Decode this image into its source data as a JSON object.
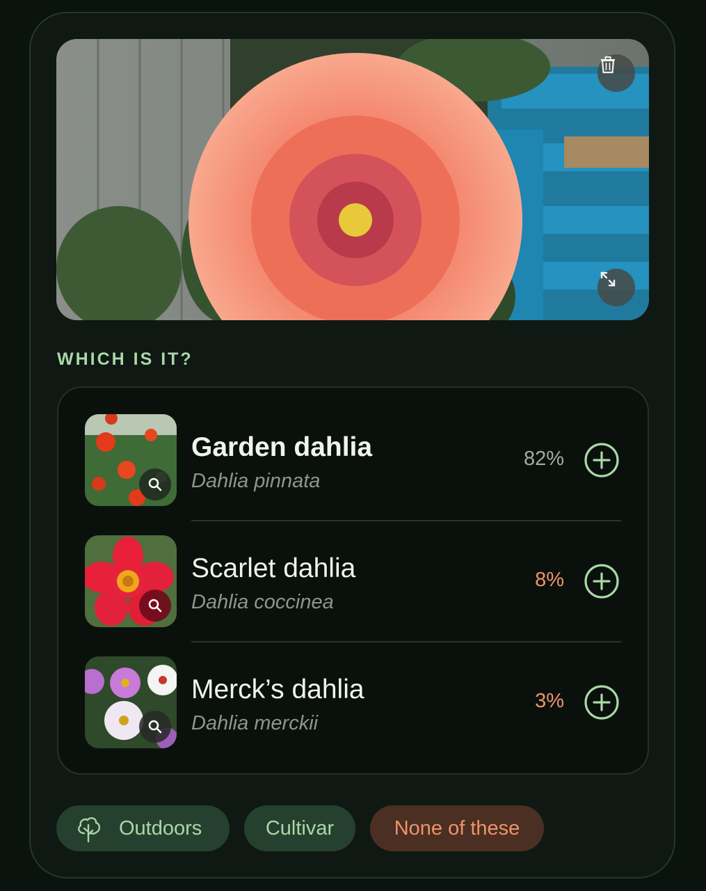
{
  "photo": {
    "subject": "dahlia-flower-photo",
    "delete_icon": "trash-icon",
    "expand_icon": "expand-icon"
  },
  "section_title": "WHICH IS IT?",
  "candidates": [
    {
      "name": "Garden dahlia",
      "scientific": "Dahlia pinnata",
      "confidence": "82%",
      "confidence_color": "#a4aba6",
      "icon": "plus-circle-icon"
    },
    {
      "name": "Scarlet dahlia",
      "scientific": "Dahlia coccinea",
      "confidence": "8%",
      "confidence_color": "#f0936b",
      "icon": "plus-circle-icon"
    },
    {
      "name": "Merck’s dahlia",
      "scientific": "Dahlia merckii",
      "confidence": "3%",
      "confidence_color": "#f0936b",
      "icon": "plus-circle-icon"
    }
  ],
  "chips": {
    "outdoors": {
      "label": "Outdoors",
      "icon": "tree-icon"
    },
    "cultivar": {
      "label": "Cultivar"
    },
    "none": {
      "label": "None of these"
    }
  },
  "colors": {
    "accent_green": "#a9d8a6",
    "chip_green_bg": "#26402f",
    "chip_orange_bg": "#4a2f22",
    "chip_orange_text": "#f0936b"
  }
}
